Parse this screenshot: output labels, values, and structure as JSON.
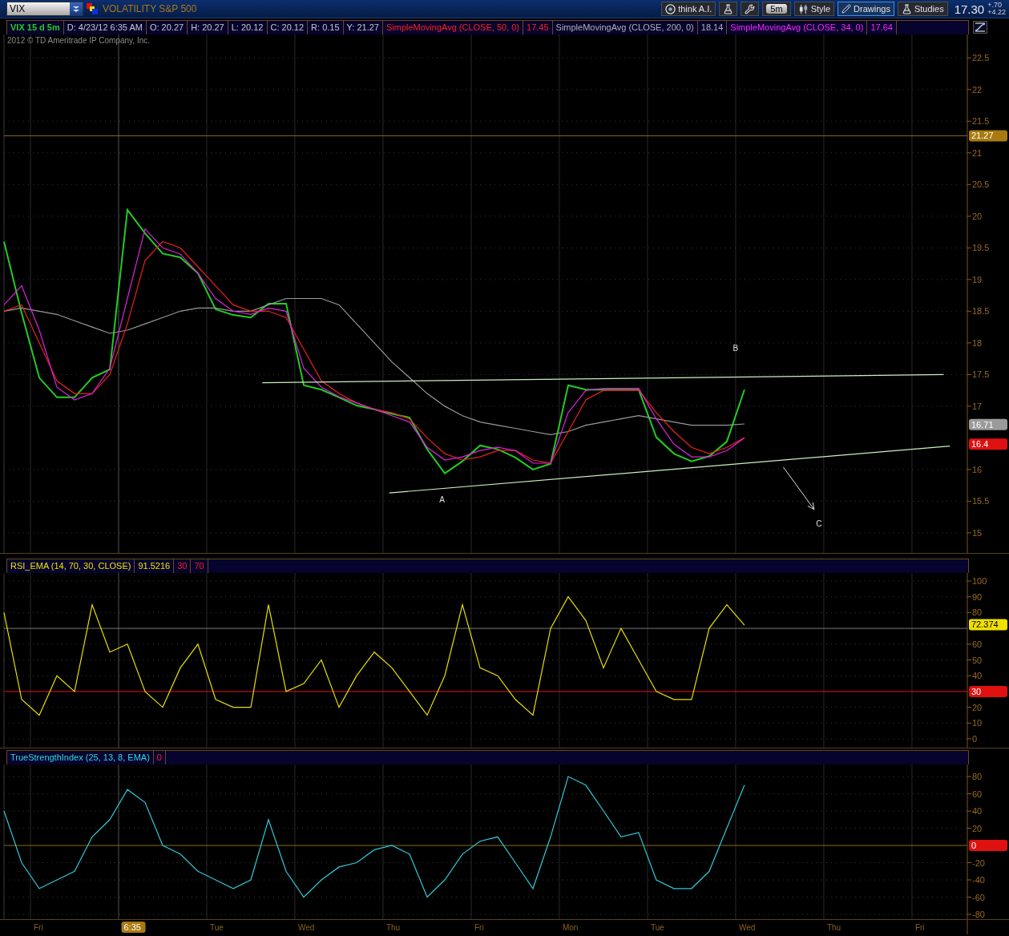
{
  "top_bar": {
    "symbol": "VIX",
    "description": "VOLATILITY S&P 500",
    "tools": [
      {
        "kind": "ai",
        "label": "think A.I.",
        "selected": false
      },
      {
        "kind": "edit-studies",
        "selected": false
      },
      {
        "kind": "wrench",
        "selected": false
      },
      {
        "kind": "timeframe",
        "label": "5m",
        "selected": false
      },
      {
        "kind": "style",
        "label": "Style",
        "selected": false
      },
      {
        "kind": "drawings",
        "label": "Drawings",
        "selected": true
      },
      {
        "kind": "studies",
        "label": "Studies",
        "selected": false
      }
    ],
    "quote": {
      "last": "17.30",
      "change": "+.70",
      "percent": "+4.22"
    }
  },
  "panes": [
    {
      "kind": "price",
      "copyright": "2012 © TD Ameritrade IP Company, Inc.",
      "chips": [
        {
          "text": "VIX 15 d 5m",
          "kind": "symbol"
        },
        {
          "text": "D: 4/23/12 6:35 AM",
          "kind": "info"
        },
        {
          "text": "O: 20.27",
          "kind": "info"
        },
        {
          "text": "H: 20.27",
          "kind": "info"
        },
        {
          "text": "L: 20.12",
          "kind": "info"
        },
        {
          "text": "C: 20.12",
          "kind": "info"
        },
        {
          "text": "R: 0.15",
          "kind": "info"
        },
        {
          "text": "Y: 21.27",
          "kind": "info"
        },
        {
          "text": "SimpleMovingAvg (CLOSE, 50, 0)",
          "kind": "sma50"
        },
        {
          "text": "17.45",
          "kind": "sma50"
        },
        {
          "text": "SimpleMovingAvg (CLOSE, 200, 0)",
          "kind": "sma200"
        },
        {
          "text": "18.14",
          "kind": "sma200"
        },
        {
          "text": "SimpleMovingAvg (CLOSE, 34, 0)",
          "kind": "sma34"
        },
        {
          "text": "17.64",
          "kind": "sma34"
        }
      ],
      "badges": [
        {
          "text": "16.71",
          "color": "#9a9a9a"
        },
        {
          "text": "16.4",
          "color": "#e01010"
        }
      ],
      "chart_data": {
        "type": "line",
        "grid": true,
        "ylim": [
          14.67,
          22.87
        ],
        "categories": [
          null,
          null,
          null,
          null,
          null,
          null,
          null,
          null,
          null,
          null,
          null,
          null,
          null,
          null,
          null,
          null,
          null,
          null,
          null,
          null,
          null,
          null,
          null,
          null,
          null,
          null,
          null,
          null,
          null,
          null,
          null,
          null,
          null,
          null,
          null,
          null,
          null,
          null,
          null,
          null,
          null,
          null,
          null,
          null,
          null,
          null,
          null,
          null,
          null,
          null,
          null,
          null,
          null,
          null,
          null
        ],
        "yticks": [
          15,
          15.5,
          16,
          17,
          17.5,
          18,
          18.5,
          19,
          19.5,
          20,
          20.5,
          21,
          21.5,
          22,
          22.5
        ],
        "series": [
          {
            "color": "#22cc22",
            "values": [
              19.6,
              18.47,
              17.45,
              17.14,
              17.14,
              17.45,
              17.58,
              20.1,
              19.73,
              19.41,
              19.35,
              19.1,
              18.53,
              18.44,
              18.4,
              18.62,
              18.62,
              17.33,
              17.26,
              17.14,
              17.01,
              16.95,
              16.88,
              16.82,
              16.32,
              15.94,
              16.13,
              16.38,
              16.32,
              16.19,
              16.0,
              16.09,
              17.33,
              17.26,
              17.26,
              17.26,
              17.26,
              16.51,
              16.25,
              16.13,
              16.21,
              16.44,
              17.26,
              null,
              null,
              null,
              null,
              null,
              null,
              null,
              null,
              null,
              null,
              null,
              null
            ]
          },
          {
            "color": "#999999",
            "values": [
              18.5,
              18.55,
              18.5,
              18.45,
              18.35,
              18.25,
              18.15,
              18.2,
              18.3,
              18.4,
              18.5,
              18.55,
              18.55,
              18.5,
              18.5,
              18.6,
              18.7,
              18.7,
              18.7,
              18.6,
              18.3,
              18.0,
              17.7,
              17.45,
              17.2,
              17.0,
              16.85,
              16.75,
              16.7,
              16.65,
              16.6,
              16.55,
              16.6,
              16.7,
              16.75,
              16.8,
              16.85,
              16.8,
              16.75,
              16.7,
              16.7,
              16.7,
              16.72,
              null,
              null,
              null,
              null,
              null,
              null,
              null,
              null,
              null,
              null,
              null,
              null
            ]
          },
          {
            "color": "#ee2020",
            "values": [
              18.5,
              18.6,
              18.0,
              17.4,
              17.2,
              17.2,
              17.5,
              18.3,
              19.3,
              19.6,
              19.5,
              19.2,
              18.9,
              18.6,
              18.5,
              18.5,
              18.4,
              17.9,
              17.4,
              17.2,
              17.05,
              16.95,
              16.9,
              16.8,
              16.5,
              16.25,
              16.15,
              16.2,
              16.3,
              16.3,
              16.15,
              16.1,
              16.6,
              17.1,
              17.25,
              17.25,
              17.25,
              16.9,
              16.6,
              16.35,
              16.25,
              16.35,
              16.5,
              null,
              null,
              null,
              null,
              null,
              null,
              null,
              null,
              null,
              null,
              null,
              null
            ]
          },
          {
            "color": "#dd22dd",
            "values": [
              18.6,
              18.9,
              18.2,
              17.3,
              17.1,
              17.2,
              17.6,
              18.7,
              19.8,
              19.5,
              19.4,
              19.1,
              18.7,
              18.5,
              18.45,
              18.55,
              18.5,
              17.6,
              17.3,
              17.15,
              17.05,
              16.95,
              16.85,
              16.75,
              16.35,
              16.15,
              16.2,
              16.3,
              16.35,
              16.3,
              16.1,
              16.1,
              16.9,
              17.25,
              17.28,
              17.28,
              17.28,
              16.8,
              16.4,
              16.2,
              16.2,
              16.3,
              16.5,
              null,
              null,
              null,
              null,
              null,
              null,
              null,
              null,
              null,
              null,
              null,
              null
            ]
          }
        ],
        "ref_lines": [
          {
            "axis": "y",
            "value": 21.27,
            "label": "21.27"
          }
        ],
        "annotations": [
          "A",
          "B",
          "C"
        ]
      }
    },
    {
      "kind": "rsi",
      "chips": [
        {
          "text": "RSI_EMA (14, 70, 30, CLOSE)",
          "kind": "rsi"
        },
        {
          "text": "91.5216",
          "kind": "rsi"
        },
        {
          "text": "30",
          "kind": "threshold"
        },
        {
          "text": "70",
          "kind": "threshold"
        }
      ],
      "badges": [
        {
          "text": "72.374",
          "color": "#f0e000"
        }
      ],
      "chart_data": {
        "type": "line",
        "grid": true,
        "ylim": [
          -6.1,
          105.1
        ],
        "categories": [
          null,
          null,
          null,
          null,
          null,
          null,
          null,
          null,
          null,
          null,
          null,
          null,
          null,
          null,
          null,
          null,
          null,
          null,
          null,
          null,
          null,
          null,
          null,
          null,
          null,
          null,
          null,
          null,
          null,
          null,
          null,
          null,
          null,
          null,
          null,
          null,
          null,
          null,
          null,
          null,
          null,
          null,
          null,
          null,
          null,
          null,
          null,
          null,
          null,
          null,
          null,
          null,
          null,
          null,
          null
        ],
        "yticks": [
          0,
          10,
          20,
          40,
          50,
          60,
          80,
          90,
          100
        ],
        "series": [
          {
            "color": "#e8e000",
            "values": [
              80,
              25,
              15,
              40,
              30,
              85,
              55,
              60,
              30,
              20,
              45,
              60,
              25,
              20,
              20,
              85,
              30,
              35,
              50,
              20,
              40,
              55,
              45,
              30,
              15,
              40,
              85,
              45,
              40,
              25,
              15,
              70,
              90,
              75,
              45,
              70,
              50,
              30,
              25,
              25,
              70,
              85,
              72,
              null,
              null,
              null,
              null,
              null,
              null,
              null,
              null,
              null,
              null,
              null,
              null
            ]
          }
        ],
        "ref_lines": [
          {
            "axis": "y",
            "value": 70
          },
          {
            "axis": "y",
            "value": 30,
            "label": "30"
          }
        ]
      }
    },
    {
      "kind": "tsi",
      "cursor_time": "6:35",
      "chips": [
        {
          "text": "TrueStrengthIndex (25, 13, 8, EMA)",
          "kind": "tsi"
        },
        {
          "text": "0",
          "kind": "threshold"
        }
      ],
      "chart_data": {
        "type": "line",
        "grid": true,
        "ylim": [
          -86.5,
          94
        ],
        "categories": [
          null,
          null,
          "Fri",
          null,
          null,
          null,
          null,
          null,
          null,
          null,
          null,
          null,
          "Tue",
          null,
          null,
          null,
          null,
          "Wed",
          null,
          null,
          null,
          null,
          "Thu",
          null,
          null,
          null,
          null,
          "Fri",
          null,
          null,
          null,
          null,
          "Mon",
          null,
          null,
          null,
          null,
          "Tue",
          null,
          null,
          null,
          null,
          "Wed",
          null,
          null,
          null,
          null,
          "Thu",
          null,
          null,
          null,
          null,
          "Fri",
          null,
          null
        ],
        "yticks": [
          -80,
          -60,
          -40,
          -20,
          20,
          40,
          60,
          80
        ],
        "series": [
          {
            "color": "#30c8d8",
            "values": [
              40,
              -20,
              -50,
              -40,
              -30,
              10,
              30,
              65,
              50,
              0,
              -10,
              -30,
              -40,
              -50,
              -40,
              30,
              -30,
              -60,
              -40,
              -25,
              -20,
              -5,
              0,
              -10,
              -60,
              -40,
              -10,
              5,
              10,
              -20,
              -50,
              10,
              80,
              70,
              40,
              10,
              15,
              -40,
              -50,
              -50,
              -30,
              20,
              70,
              null,
              null,
              null,
              null,
              null,
              null,
              null,
              null,
              null,
              null,
              null,
              null
            ]
          }
        ],
        "ref_lines": [
          {
            "axis": "y",
            "value": 0,
            "label": "0"
          }
        ]
      }
    }
  ]
}
